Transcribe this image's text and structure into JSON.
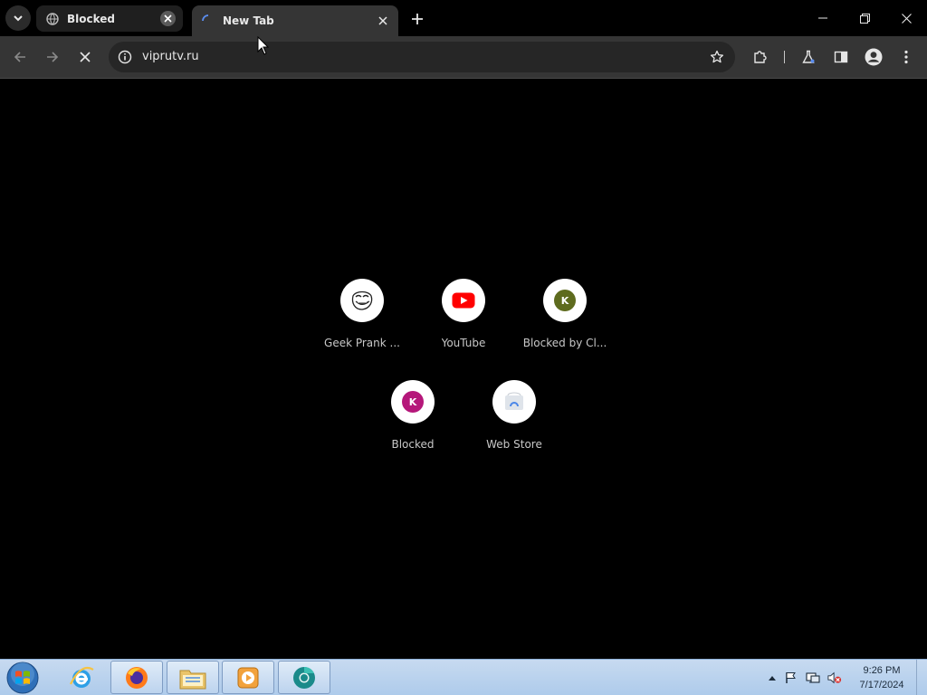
{
  "tabs": [
    {
      "title": "Blocked",
      "favicon": "globe-icon"
    },
    {
      "title": "New Tab",
      "favicon": "loading-spinner-icon"
    }
  ],
  "toolbar": {
    "url": "viprutv.ru",
    "reload_state": "stop-loading"
  },
  "shortcuts_row1": [
    {
      "label": "Geek Prank ...",
      "icon": "troll-face-icon"
    },
    {
      "label": "YouTube",
      "icon": "youtube-icon"
    },
    {
      "label": "Blocked by Cl...",
      "icon": "letter-k-icon",
      "letter": "K",
      "color": "#5e6b1e"
    }
  ],
  "shortcuts_row2": [
    {
      "label": "Blocked",
      "icon": "letter-k-icon",
      "letter": "K",
      "color": "#b5177a"
    },
    {
      "label": "Web Store",
      "icon": "web-store-icon"
    }
  ],
  "taskbar": {
    "apps": [
      "internet-explorer-icon",
      "firefox-icon",
      "file-explorer-icon",
      "media-player-icon",
      "chrome-canary-icon"
    ]
  },
  "clock": {
    "time": "9:26 PM",
    "date": "7/17/2024"
  },
  "colors": {
    "page_bg": "#000000",
    "toolbar_bg": "#353535",
    "omnibox_bg": "#262626",
    "taskbar": "#b9d1ea"
  }
}
